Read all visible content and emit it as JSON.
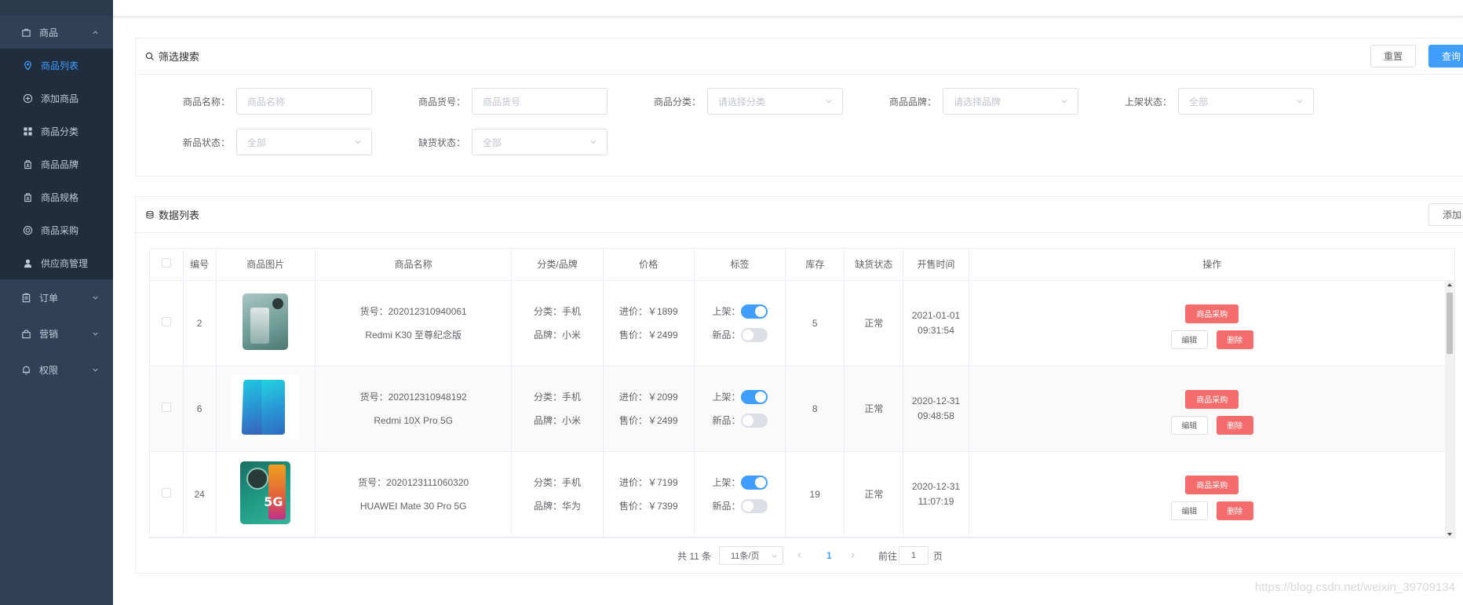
{
  "sidebar": {
    "group_goods": "商品",
    "items": [
      {
        "label": "商品列表",
        "icon": "location-icon",
        "active": true
      },
      {
        "label": "添加商品",
        "icon": "plus-circle-icon",
        "active": false
      },
      {
        "label": "商品分类",
        "icon": "grid-icon",
        "active": false
      },
      {
        "label": "商品品牌",
        "icon": "brand-icon",
        "active": false
      },
      {
        "label": "商品规格",
        "icon": "spec-icon",
        "active": false
      },
      {
        "label": "商品采购",
        "icon": "purchase-icon",
        "active": false
      },
      {
        "label": "供应商管理",
        "icon": "user-icon",
        "active": false
      }
    ],
    "group_order": "订单",
    "group_marketing": "营销",
    "group_permission": "权限"
  },
  "filter": {
    "title": "筛选搜索",
    "reset_label": "重置",
    "query_label": "查询",
    "name_label": "商品名称：",
    "name_placeholder": "商品名称",
    "sn_label": "商品货号：",
    "sn_placeholder": "商品货号",
    "category_label": "商品分类：",
    "category_placeholder": "请选择分类",
    "brand_label": "商品品牌：",
    "brand_placeholder": "请选择品牌",
    "publish_label": "上架状态：",
    "publish_value": "全部",
    "new_label": "新品状态：",
    "new_value": "全部",
    "stockout_label": "缺货状态：",
    "stockout_value": "全部"
  },
  "data": {
    "title": "数据列表",
    "add_label": "添加",
    "columns": [
      "编号",
      "商品图片",
      "商品名称",
      "分类/品牌",
      "价格",
      "标签",
      "库存",
      "缺货状态",
      "开售时间",
      "操作"
    ],
    "rows": [
      {
        "id": "2",
        "sn": "货号：202012310940061",
        "name": "Redmi K30 至尊纪念版",
        "category": "分类：手机",
        "brand": "品牌：小米",
        "cost": "进价：￥1899",
        "price": "售价：￥2499",
        "publish_label": "上架：",
        "publish_on": true,
        "new_label": "新品：",
        "new_on": false,
        "stock": "5",
        "stock_status": "正常",
        "date": "2021-01-01",
        "time": "09:31:54",
        "phone_color": "#7aa7a2",
        "striped": false
      },
      {
        "id": "6",
        "sn": "货号：202012310948192",
        "name": "Redmi 10X Pro 5G",
        "category": "分类：手机",
        "brand": "品牌：小米",
        "cost": "进价：￥2099",
        "price": "售价：￥2499",
        "publish_label": "上架：",
        "publish_on": true,
        "new_label": "新品：",
        "new_on": false,
        "stock": "8",
        "stock_status": "正常",
        "date": "2020-12-31",
        "time": "09:48:58",
        "phone_color": "#2fb8d8",
        "striped": true
      },
      {
        "id": "24",
        "sn": "货号：2020123111060320",
        "name": "HUAWEI Mate 30 Pro 5G",
        "category": "分类：手机",
        "brand": "品牌：华为",
        "cost": "进价：￥7199",
        "price": "售价：￥7399",
        "publish_label": "上架：",
        "publish_on": true,
        "new_label": "新品：",
        "new_on": false,
        "stock": "19",
        "stock_status": "正常",
        "date": "2020-12-31",
        "time": "11:07:19",
        "phone_color": "#1f8f7a",
        "striped": false
      }
    ],
    "op_purchase": "商品采购",
    "op_edit": "编辑",
    "op_delete": "删除"
  },
  "pager": {
    "total": "共 11 条",
    "page_size": "11条/页",
    "current": "1",
    "goto_label": "前往",
    "goto_value": "1",
    "page_unit": "页"
  },
  "watermark": "https://blog.csdn.net/weixin_39709134",
  "colors": {
    "sidebar_bg": "#304156",
    "submenu_bg": "#1f2d3d",
    "accent": "#409eff",
    "danger": "#f56c6c"
  }
}
